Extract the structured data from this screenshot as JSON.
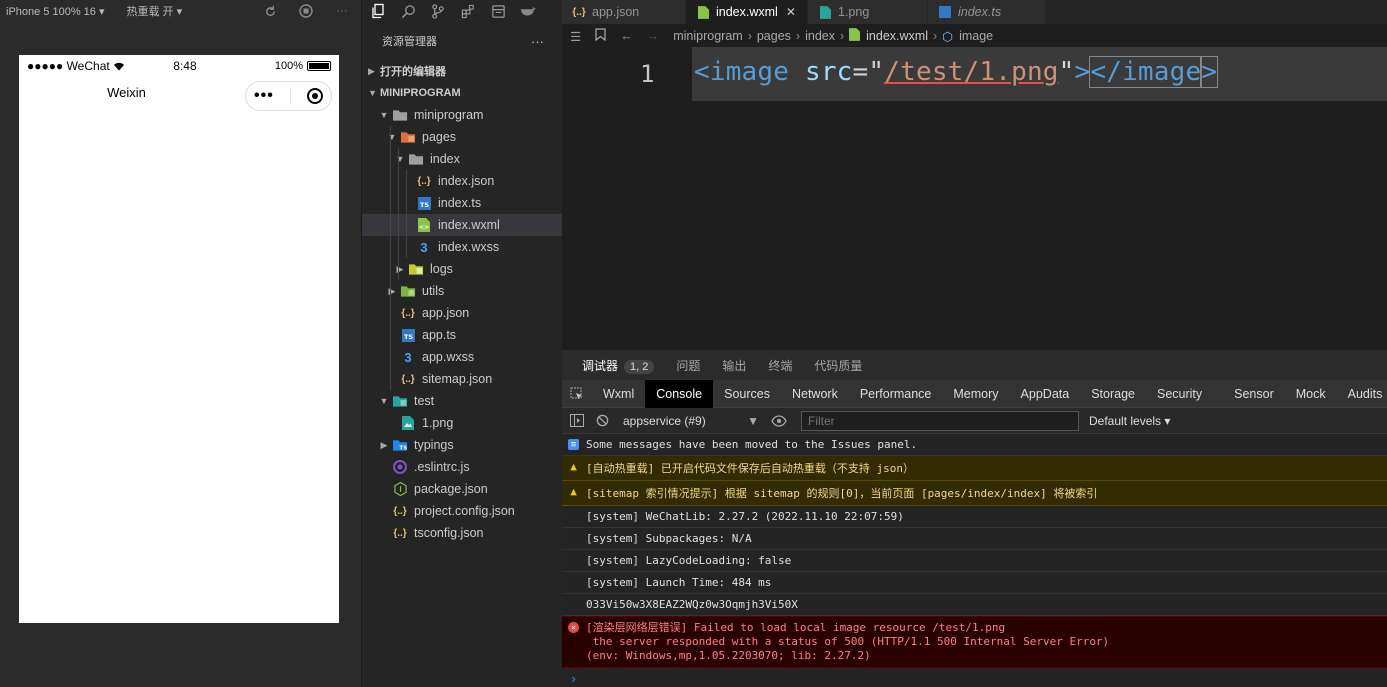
{
  "simulator": {
    "device": "iPhone 5 100% 16 ▾",
    "hot_reload": "热重载 开 ▾",
    "status": {
      "carrier": "●●●●● WeChat",
      "time": "8:48",
      "battery": "100%"
    },
    "nav_title": "Weixin",
    "capsule_dots": "•••"
  },
  "explorer": {
    "header": "资源管理器",
    "more": "···",
    "open_editors": "打开的编辑器",
    "project": "MINIPROGRAM",
    "tree": [
      {
        "label": "miniprogram",
        "type": "folder"
      },
      {
        "label": "pages",
        "type": "folder"
      },
      {
        "label": "index",
        "type": "folder"
      },
      {
        "label": "index.json",
        "type": "json"
      },
      {
        "label": "index.ts",
        "type": "ts"
      },
      {
        "label": "index.wxml",
        "type": "wxml"
      },
      {
        "label": "index.wxss",
        "type": "wxss"
      },
      {
        "label": "logs",
        "type": "folder"
      },
      {
        "label": "utils",
        "type": "folder"
      },
      {
        "label": "app.json",
        "type": "json"
      },
      {
        "label": "app.ts",
        "type": "ts"
      },
      {
        "label": "app.wxss",
        "type": "wxss"
      },
      {
        "label": "sitemap.json",
        "type": "json"
      },
      {
        "label": "test",
        "type": "folder"
      },
      {
        "label": "1.png",
        "type": "png"
      },
      {
        "label": "typings",
        "type": "folder"
      },
      {
        "label": ".eslintrc.js",
        "type": "eslint"
      },
      {
        "label": "package.json",
        "type": "npm"
      },
      {
        "label": "project.config.json",
        "type": "json"
      },
      {
        "label": "tsconfig.json",
        "type": "json"
      }
    ]
  },
  "editor": {
    "tabs": [
      {
        "label": "app.json"
      },
      {
        "label": "index.wxml"
      },
      {
        "label": "1.png"
      },
      {
        "label": "index.ts"
      }
    ],
    "breadcrumbs": [
      "miniprogram",
      "pages",
      "index",
      "index.wxml",
      "image"
    ],
    "line_number": "1",
    "code": {
      "open_tag": "<image",
      "attr": " src",
      "eq": "=\"",
      "value": "/test/1.png",
      "quote_close": "\"",
      "gt": ">",
      "close_tag": "</image",
      "gt2": ">"
    }
  },
  "devtools": {
    "top_tabs": [
      "调试器",
      "问题",
      "输出",
      "终端",
      "代码质量"
    ],
    "badge": "1, 2",
    "panel_tabs": [
      "Wxml",
      "Console",
      "Sources",
      "Network",
      "Performance",
      "Memory",
      "AppData",
      "Storage",
      "Security",
      "Sensor",
      "Mock",
      "Audits"
    ],
    "context": "appservice (#9)",
    "filter_placeholder": "Filter",
    "levels": "Default levels ▾",
    "messages": [
      {
        "level": "info",
        "text": "Some messages have been moved to the Issues panel."
      },
      {
        "level": "warn",
        "text": "[自动热重载] 已开启代码文件保存后自动热重载（不支持 json）"
      },
      {
        "level": "warn",
        "text": "[sitemap 索引情况提示] 根据 sitemap 的规则[0]，当前页面 [pages/index/index] 将被索引"
      },
      {
        "level": "log",
        "text": "[system] WeChatLib: 2.27.2 (2022.11.10 22:07:59)"
      },
      {
        "level": "log",
        "text": "[system] Subpackages: N/A"
      },
      {
        "level": "log",
        "text": "[system] LazyCodeLoading: false"
      },
      {
        "level": "log",
        "text": "[system] Launch Time: 484 ms"
      },
      {
        "level": "log",
        "text": "033Vi50w3X8EAZ2WQz0w3Oqmjh3Vi50X"
      },
      {
        "level": "error",
        "text": "[渲染层网络层错误] Failed to load local image resource /test/1.png\n the server responded with a status of 500 (HTTP/1.1 500 Internal Server Error)\n(env: Windows,mp,1.05.2203070; lib: 2.27.2)"
      }
    ],
    "prompt": "›"
  }
}
